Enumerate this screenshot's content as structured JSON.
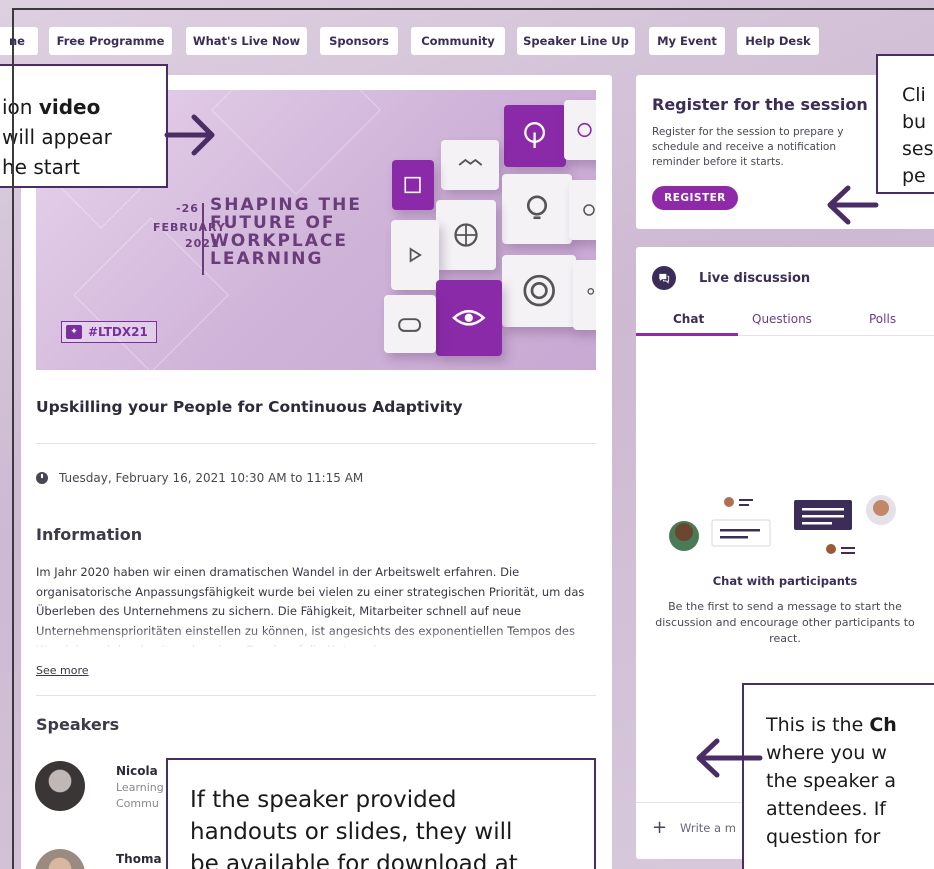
{
  "nav": {
    "items": [
      {
        "label": "ne"
      },
      {
        "label": "Free Programme"
      },
      {
        "label": "What's Live Now"
      },
      {
        "label": "Sponsors"
      },
      {
        "label": "Community"
      },
      {
        "label": "Speaker Line Up"
      },
      {
        "label": "My Event"
      },
      {
        "label": "Help Desk"
      }
    ]
  },
  "banner": {
    "date_line1": "-26",
    "date_line2": "FEBRUARY",
    "date_line3": "2021",
    "title_line1": "SHAPING THE",
    "title_line2": "FUTURE OF",
    "title_line3": "WORKPLACE",
    "title_line4": "LEARNING",
    "hashtag": "#LTDX21"
  },
  "session": {
    "title": "Upskilling your People for Continuous Adaptivity",
    "datetime": "Tuesday, February 16, 2021 10:30 AM to 11:15 AM",
    "info_heading": "Information",
    "info_text": "Im Jahr 2020 haben wir einen dramatischen Wandel in der Arbeitswelt erfahren. Die organisatorische Anpassungsfähigkeit wurde bei vielen zu einer strategischen Priorität, um das Überleben des Unternehmens zu sichern. Die Fähigkeit, Mitarbeiter schnell auf neue Unternehmensprioritäten einstellen zu können, ist angesichts des exponentiellen Tempos des Wandels und der damit verbundene Druck auf die Unternehmen, von",
    "see_more": "See more",
    "speakers_heading": "Speakers",
    "speakers": [
      {
        "name": "Nicola",
        "role_line1": "Learning",
        "role_line2": "Commu"
      },
      {
        "name": "Thoma"
      }
    ]
  },
  "register": {
    "title": "Register for the session",
    "description": "Register for the session to prepare y schedule and receive a notification reminder before it starts.",
    "button": "REGISTER"
  },
  "discussion": {
    "title": "Live discussion",
    "tabs": [
      {
        "label": "Chat"
      },
      {
        "label": "Questions"
      },
      {
        "label": "Polls"
      }
    ],
    "empty_title": "Chat with participants",
    "empty_desc": "Be the first to send a message to start the discussion and encourage other participants to react.",
    "input_placeholder": "Write a m"
  },
  "callouts": {
    "video": {
      "line1_pre": "ion ",
      "line1_bold": "video",
      "line2": "will appear",
      "line3": "he start"
    },
    "register": {
      "line1": "Cli",
      "line2": "bu",
      "line3": "ses",
      "line4": "pe"
    },
    "chat": {
      "line1_pre": "This is the ",
      "line1_bold": "Ch",
      "line2": "where you w",
      "line3": "the speaker a",
      "line4": "attendees. If",
      "line5": "question for"
    },
    "handouts": {
      "line1": "If the speaker provided",
      "line2": "handouts or slides, they will",
      "line3": "be available for download at"
    }
  },
  "colors": {
    "accent": "#8e2aa8",
    "navy": "#3b2d58",
    "background": "#d6c6da"
  }
}
